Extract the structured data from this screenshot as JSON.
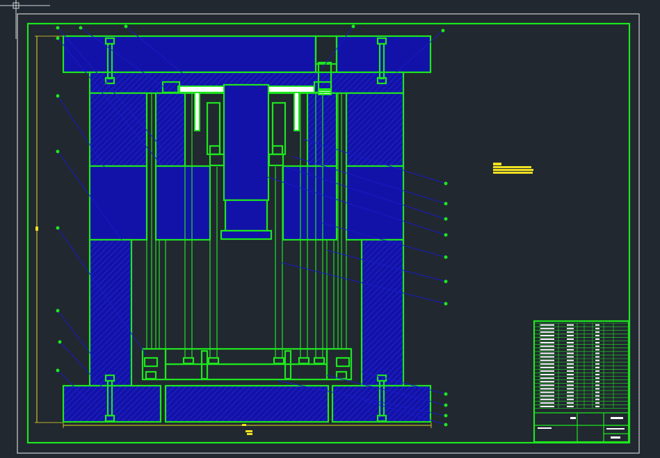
{
  "drawing": {
    "type": "injection mold assembly drawing",
    "colors": {
      "background": "#212830",
      "outline": "#1ee61e",
      "plate_fill": "#1212a8",
      "leader": "#1a1ac8",
      "highlight": "#f0e020",
      "sheet_border": "#cfcfcf"
    },
    "balloon_count_left": 8,
    "balloon_count_top": 3,
    "balloon_count_right": 11,
    "title_block_rows": 24
  }
}
